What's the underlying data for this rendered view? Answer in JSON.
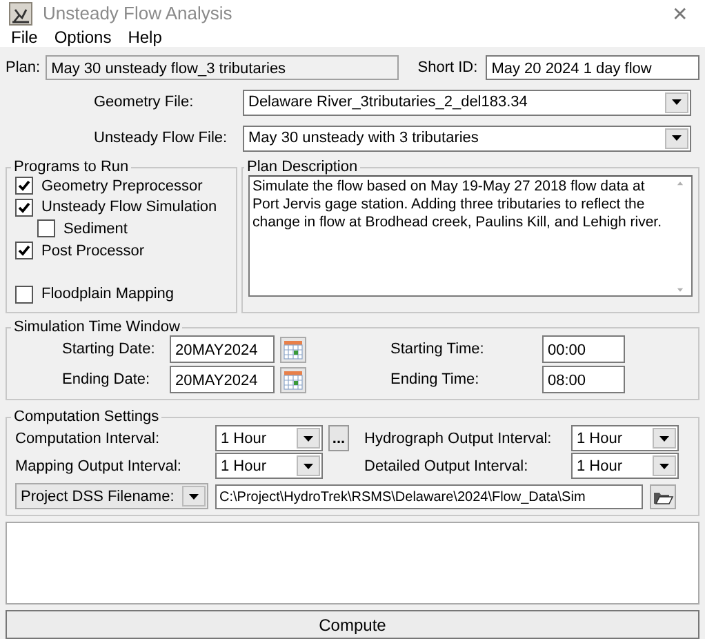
{
  "window": {
    "title": "Unsteady Flow Analysis",
    "close": "✕"
  },
  "menu": [
    "File",
    "Options",
    "Help"
  ],
  "plan": {
    "label": "Plan:",
    "value": "May 30 unsteady flow_3 tributaries"
  },
  "short_id": {
    "label": "Short ID:",
    "value": "May 20 2024 1 day flow"
  },
  "geometry_file": {
    "label": "Geometry File:",
    "value": "Delaware River_3tributaries_2_del183.34"
  },
  "unsteady_flow_file": {
    "label": "Unsteady Flow File:",
    "value": "May 30 unsteady with 3 tributaries"
  },
  "programs_to_run": {
    "title": "Programs to Run",
    "items": [
      {
        "label": "Geometry Preprocessor",
        "checked": true
      },
      {
        "label": "Unsteady Flow Simulation",
        "checked": true,
        "children": [
          {
            "label": "Sediment",
            "checked": false
          }
        ]
      },
      {
        "label": "Post Processor",
        "checked": true
      },
      {
        "label": "Floodplain Mapping",
        "checked": false
      }
    ]
  },
  "plan_description": {
    "title": "Plan Description",
    "text": "Simulate the flow based on May 19-May 27 2018 flow data at Port Jervis gage station. Adding three tributaries to reflect the change in flow at Brodhead creek, Paulins Kill, and Lehigh river."
  },
  "simulation_time_window": {
    "title": "Simulation Time Window",
    "fields": [
      {
        "kind": "date",
        "label": "Starting Date:",
        "value": "20MAY2024"
      },
      {
        "kind": "time",
        "label": "Starting Time:",
        "value": "00:00"
      },
      {
        "kind": "date",
        "label": "Ending Date:",
        "value": "20MAY2024"
      },
      {
        "kind": "time",
        "label": "Ending Time:",
        "value": "08:00"
      }
    ]
  },
  "computation_settings": {
    "title": "Computation Settings",
    "options_button": "...",
    "intervals": [
      {
        "label": "Computation Interval:",
        "value": "1 Hour"
      },
      {
        "label": "Hydrograph Output Interval:",
        "value": "1 Hour"
      },
      {
        "label": "Mapping Output Interval:",
        "value": "1 Hour"
      },
      {
        "label": "Detailed Output Interval:",
        "value": "1 Hour"
      }
    ],
    "dss_selector": "Project DSS Filename:",
    "dss_path": "C:\\Project\\HydroTrek\\RSMS\\Delaware\\2024\\Flow_Data\\Sim"
  },
  "buttons": [
    "Compute"
  ]
}
